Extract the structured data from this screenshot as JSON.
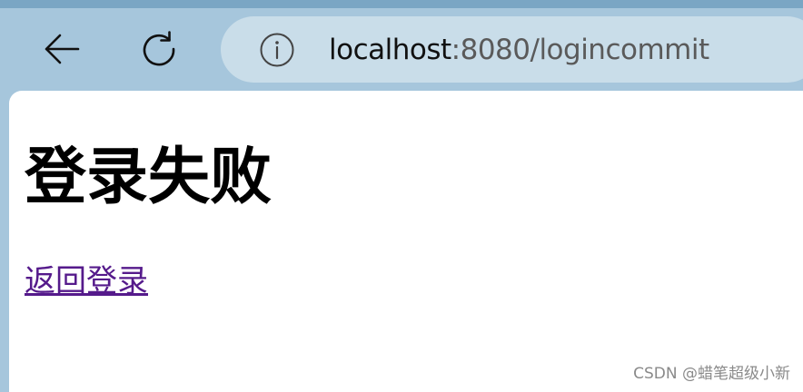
{
  "browser": {
    "address_bar": {
      "url_host": "localhost",
      "url_rest": ":8080/logincommit"
    },
    "icons": {
      "back": "back-arrow-icon",
      "reload": "reload-icon",
      "site_info": "info-icon"
    }
  },
  "page": {
    "title": "登录失败",
    "link_label": "返回登录"
  },
  "watermark": "CSDN @蜡笔超级小新",
  "colors": {
    "toolbar_bg": "#a6c6dc",
    "address_bar_bg": "#c9dde9",
    "visited_link": "#551a8b"
  }
}
